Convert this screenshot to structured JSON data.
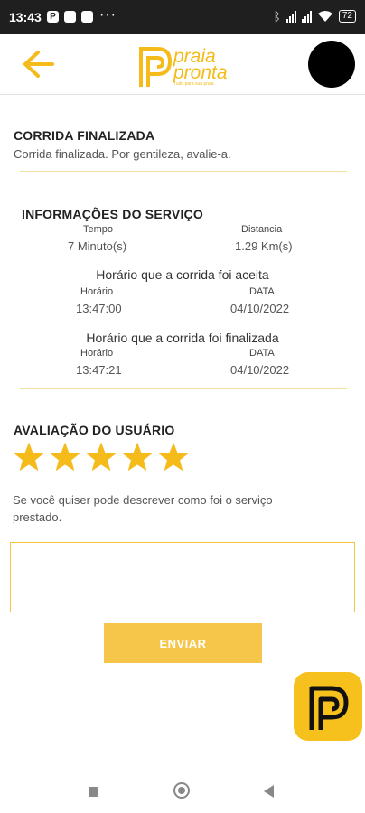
{
  "status_bar": {
    "time": "13:43",
    "battery": "72",
    "left_icons": [
      "P",
      "■",
      "■"
    ],
    "dots": "···"
  },
  "colors": {
    "accent": "#f4bb1a",
    "button": "#f6c64a",
    "divider": "#f2dea0"
  },
  "header": {
    "logo_line1": "praia",
    "logo_line2": "pronta",
    "logo_tagline": "Tudo para sua praia"
  },
  "ride": {
    "title": "CORRIDA FINALIZADA",
    "subtitle": "Corrida finalizada. Por gentileza, avalie-a."
  },
  "service": {
    "title": "INFORMAÇÕES DO SERVIÇO",
    "time_label": "Tempo",
    "time_value": "7 Minuto(s)",
    "distance_label": "Distancia",
    "distance_value": "1.29 Km(s)",
    "accepted_title": "Horário que a corrida foi aceita",
    "accepted_time_label": "Horário",
    "accepted_time": "13:47:00",
    "accepted_date_label": "DATA",
    "accepted_date": "04/10/2022",
    "finished_title": "Horário que a corrida foi finalizada",
    "finished_time_label": "Horário",
    "finished_time": "13:47:21",
    "finished_date_label": "DATA",
    "finished_date": "04/10/2022"
  },
  "rating": {
    "title": "AVALIAÇÃO DO USUÁRIO",
    "stars": 5,
    "max_stars": 5
  },
  "feedback": {
    "note": "Se você quiser pode descrever como foi o serviço prestado.",
    "value": "",
    "placeholder": ""
  },
  "send_label": "ENVIAR",
  "icons": {
    "back": "arrow-left-icon",
    "fab": "praia-pronta-logo-icon"
  }
}
